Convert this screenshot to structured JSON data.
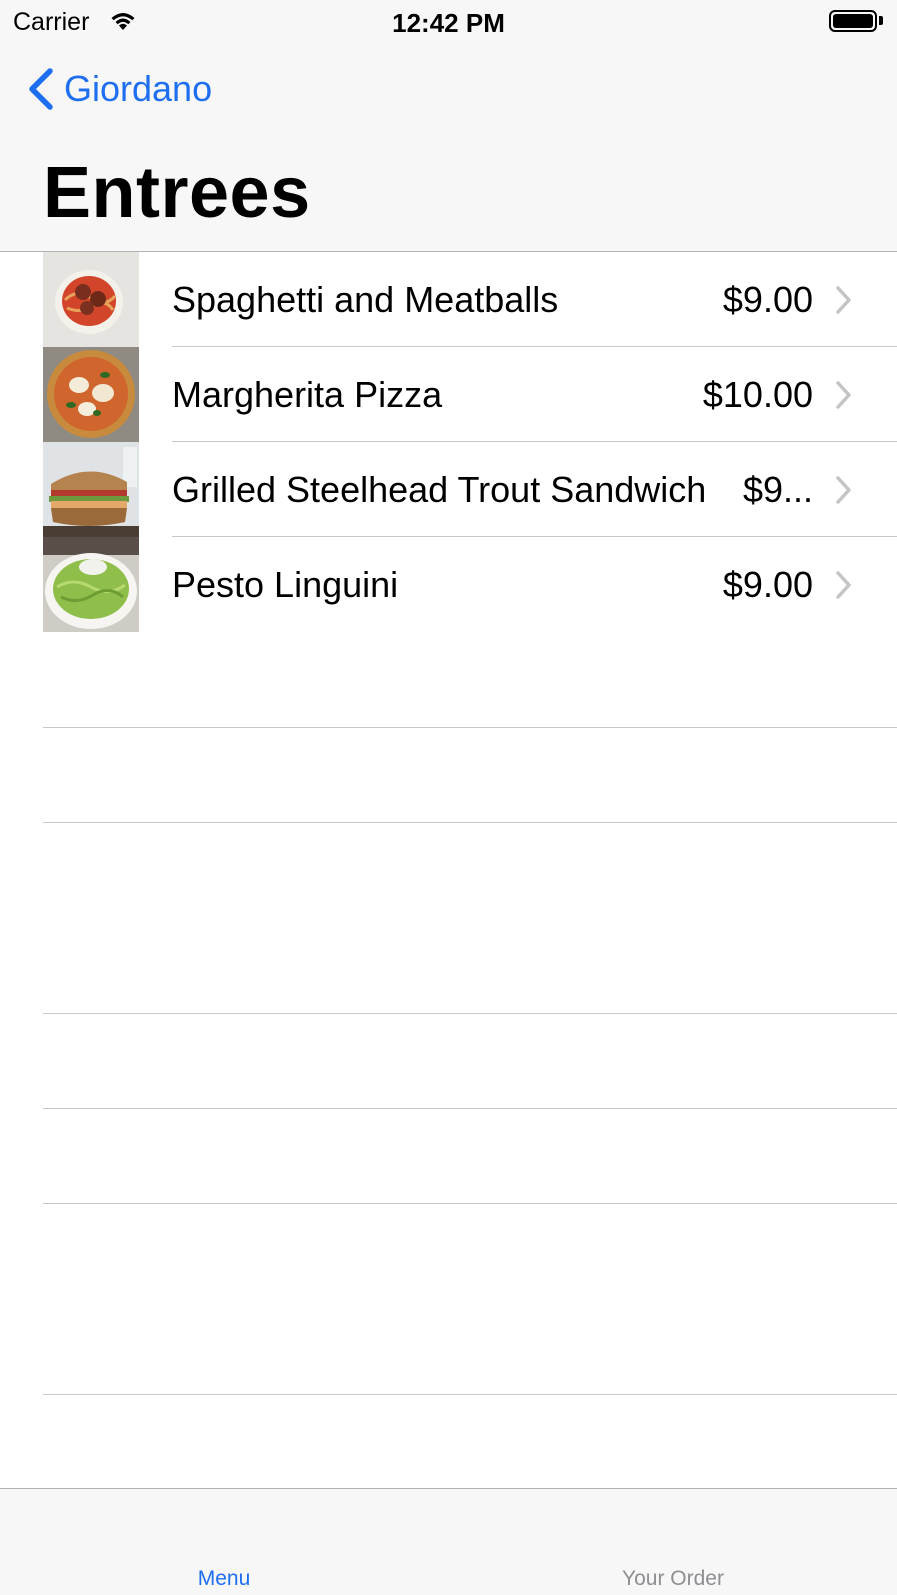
{
  "status_bar": {
    "carrier": "Carrier",
    "time": "12:42 PM"
  },
  "nav": {
    "back_label": "Giordano",
    "title": "Entrees"
  },
  "menu_items": [
    {
      "name": "Spaghetti and Meatballs",
      "price": "$9.00",
      "image": "spaghetti-meatballs-photo"
    },
    {
      "name": "Margherita Pizza",
      "price": "$10.00",
      "image": "margherita-pizza-photo"
    },
    {
      "name": "Grilled Steelhead Trout Sandwich",
      "price": "$9...",
      "image": "trout-sandwich-photo"
    },
    {
      "name": "Pesto Linguini",
      "price": "$9.00",
      "image": "pesto-linguini-photo"
    }
  ],
  "tabs": [
    {
      "label": "Menu",
      "selected": true
    },
    {
      "label": "Your Order",
      "selected": false
    }
  ],
  "colors": {
    "accent": "#1e6ff0",
    "bar_background": "#f7f7f7",
    "separator": "#c8c7cc",
    "inactive_tab": "#8e8e93"
  }
}
